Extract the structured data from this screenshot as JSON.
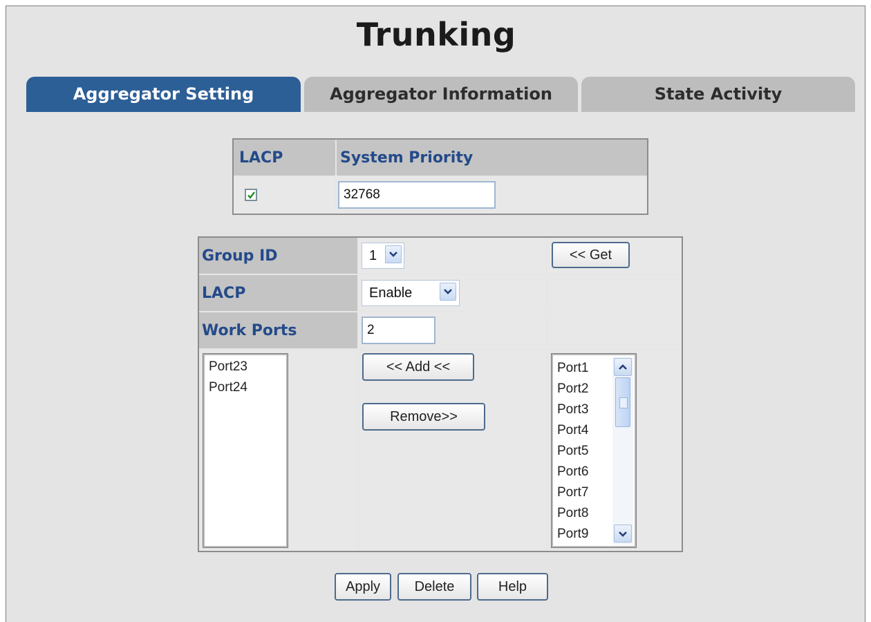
{
  "page_title": "Trunking",
  "tabs": [
    {
      "label": "Aggregator Setting",
      "active": true
    },
    {
      "label": "Aggregator Information",
      "active": false
    },
    {
      "label": "State Activity",
      "active": false
    }
  ],
  "lacp_system": {
    "lacp_header": "LACP",
    "priority_header": "System Priority",
    "lacp_checked": true,
    "priority_value": "32768"
  },
  "group": {
    "group_id_label": "Group ID",
    "group_id_value": "1",
    "get_button": "<< Get",
    "lacp_label": "LACP",
    "lacp_value": "Enable",
    "work_ports_label": "Work Ports",
    "work_ports_value": "2",
    "member_ports": [
      "Port23",
      "Port24"
    ],
    "add_button": "<< Add <<",
    "remove_button": "Remove>>",
    "available_ports": [
      "Port1",
      "Port2",
      "Port3",
      "Port4",
      "Port5",
      "Port6",
      "Port7",
      "Port8",
      "Port9"
    ]
  },
  "actions": {
    "apply": "Apply",
    "delete": "Delete",
    "help": "Help"
  },
  "colors": {
    "active_tab": "#2d5f97",
    "inactive_tab": "#bdbdbd",
    "label_text": "#234a8a"
  }
}
